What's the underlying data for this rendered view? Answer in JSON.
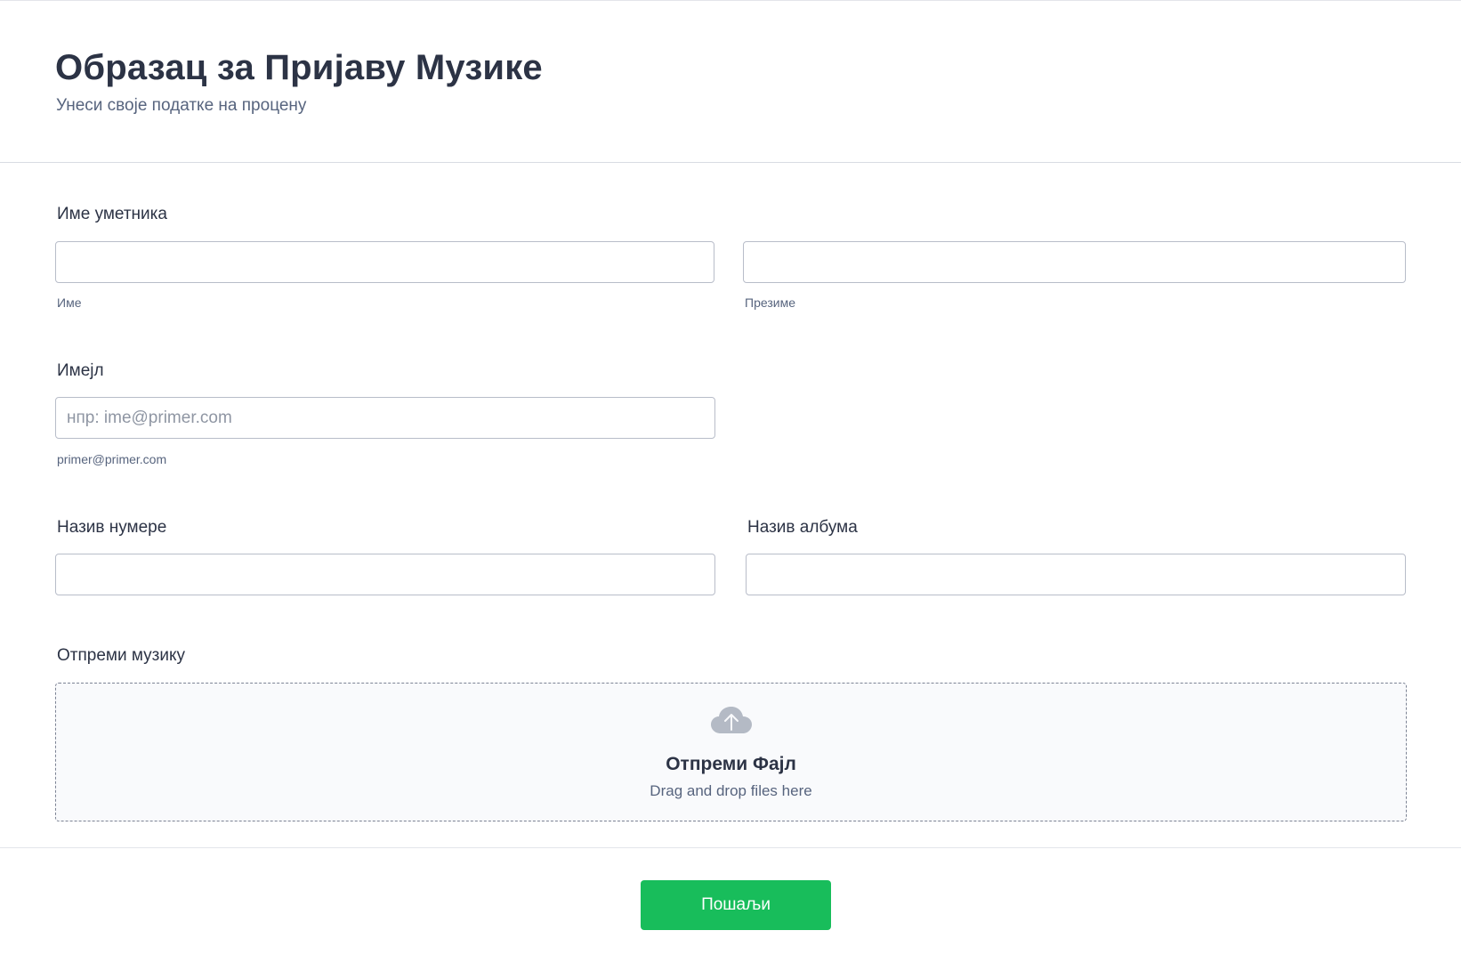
{
  "header": {
    "title": "Образац за Пријаву Музике",
    "subtitle": "Унеси своје податке на процену"
  },
  "artist_name": {
    "label": "Име уметника",
    "first_sublabel": "Име",
    "last_sublabel": "Презиме",
    "first_value": "",
    "last_value": ""
  },
  "email": {
    "label": "Имејл",
    "placeholder": "нпр: ime@primer.com",
    "sublabel": "primer@primer.com",
    "value": ""
  },
  "track": {
    "label": "Назив нумере",
    "value": ""
  },
  "album": {
    "label": "Назив албума",
    "value": ""
  },
  "upload": {
    "label": "Отпреми музику",
    "title": "Отпреми Фајл",
    "subtitle": "Drag and drop files here",
    "icon": "cloud-upload-icon"
  },
  "submit": {
    "label": "Пошаљи"
  },
  "colors": {
    "accent": "#18bd5b",
    "text": "#2c3345",
    "muted": "#57647e",
    "border": "#b8bdc9"
  }
}
